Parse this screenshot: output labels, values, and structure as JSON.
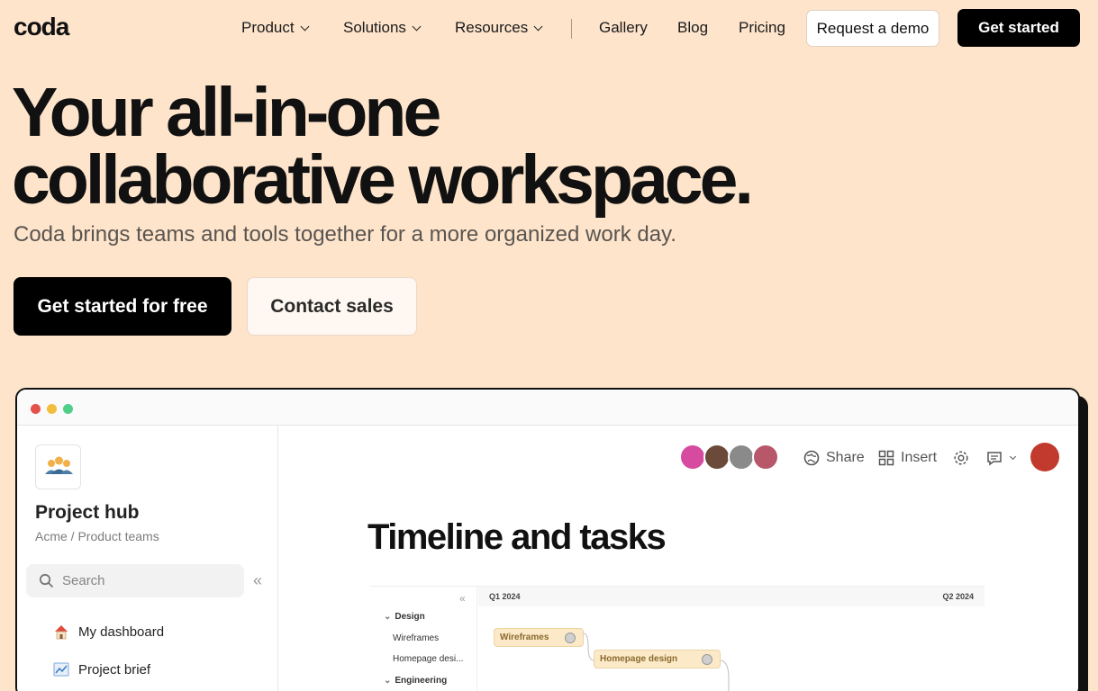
{
  "nav": {
    "logo": "coda",
    "items": [
      {
        "label": "Product",
        "dropdown": true
      },
      {
        "label": "Solutions",
        "dropdown": true
      },
      {
        "label": "Resources",
        "dropdown": true
      },
      {
        "label": "Gallery",
        "dropdown": false
      },
      {
        "label": "Blog",
        "dropdown": false
      },
      {
        "label": "Pricing",
        "dropdown": false
      }
    ],
    "demo_label": "Request a demo",
    "start_label": "Get started"
  },
  "hero": {
    "title_line1": "Your all-in-one",
    "title_line2": "collaborative workspace.",
    "subtitle": "Coda brings teams and tools together for a more organized work day.",
    "cta_primary": "Get started for free",
    "cta_secondary": "Contact sales"
  },
  "app": {
    "sidebar": {
      "doc_title": "Project hub",
      "doc_path": "Acme / Product teams",
      "search_placeholder": "Search",
      "items": [
        {
          "label": "My dashboard",
          "icon": "house-icon"
        },
        {
          "label": "Project brief",
          "icon": "chart-icon"
        }
      ]
    },
    "toolbar": {
      "share_label": "Share",
      "insert_label": "Insert"
    },
    "page_title": "Timeline and tasks",
    "timeline": {
      "quarters": [
        "Q1 2024",
        "Q2 2024"
      ],
      "groups": [
        {
          "label": "Design",
          "rows": [
            "Wireframes",
            "Homepage desi..."
          ]
        },
        {
          "label": "Engineering",
          "rows": []
        }
      ],
      "bars": [
        "Wireframes",
        "Homepage design"
      ]
    }
  },
  "colors": {
    "page_bg": "#fde4cb",
    "primary": "#000000",
    "bar_fill": "#fbe9c8"
  }
}
